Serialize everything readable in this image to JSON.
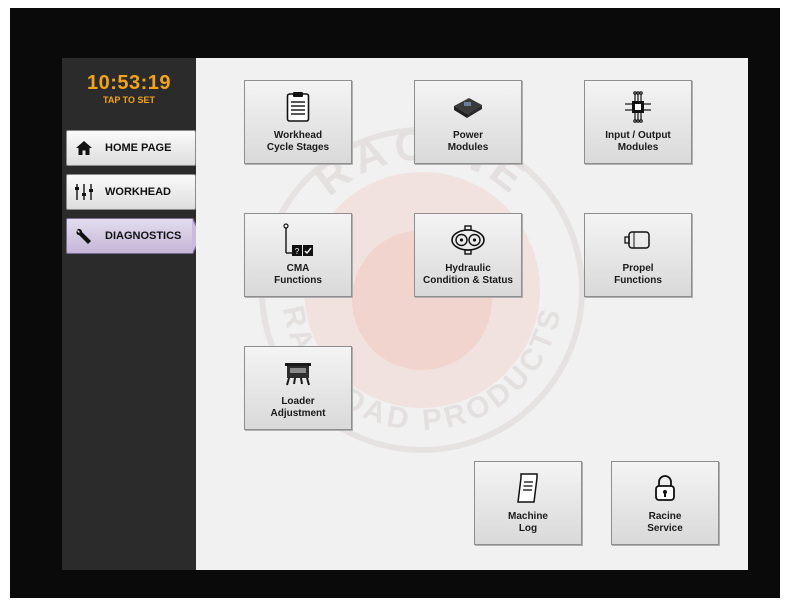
{
  "clock": {
    "time": "10:53:19",
    "tap_label": "TAP TO SET"
  },
  "nav": [
    {
      "label": "HOME PAGE",
      "icon": "home-icon"
    },
    {
      "label": "WORKHEAD",
      "icon": "sliders-icon"
    },
    {
      "label": "DIAGNOSTICS",
      "icon": "wrench-icon",
      "active": true
    }
  ],
  "watermark": {
    "text_top": "RACINE",
    "text_bottom": "RAILROAD PRODUCTS"
  },
  "tiles": [
    {
      "label": "Workhead\nCycle Stages",
      "icon": "clipboard-icon"
    },
    {
      "label": "Power\nModules",
      "icon": "power-module-icon"
    },
    {
      "label": "Input / Output\nModules",
      "icon": "io-chip-icon"
    },
    {
      "label": "CMA\nFunctions",
      "icon": "cma-switch-icon"
    },
    {
      "label": "Hydraulic\nCondition & Status",
      "icon": "hydraulic-pump-icon"
    },
    {
      "label": "Propel\nFunctions",
      "icon": "propel-motor-icon"
    },
    {
      "label": "Loader\nAdjustment",
      "icon": "loader-icon"
    },
    {
      "label": "Machine\nLog",
      "icon": "scroll-log-icon"
    },
    {
      "label": "Racine\nService",
      "icon": "padlock-icon"
    }
  ],
  "colors": {
    "clock": "#f2a31a",
    "active_nav": "#c5b7d8",
    "sidebar": "#2b2b2b",
    "panel": "#f1f1f1"
  }
}
